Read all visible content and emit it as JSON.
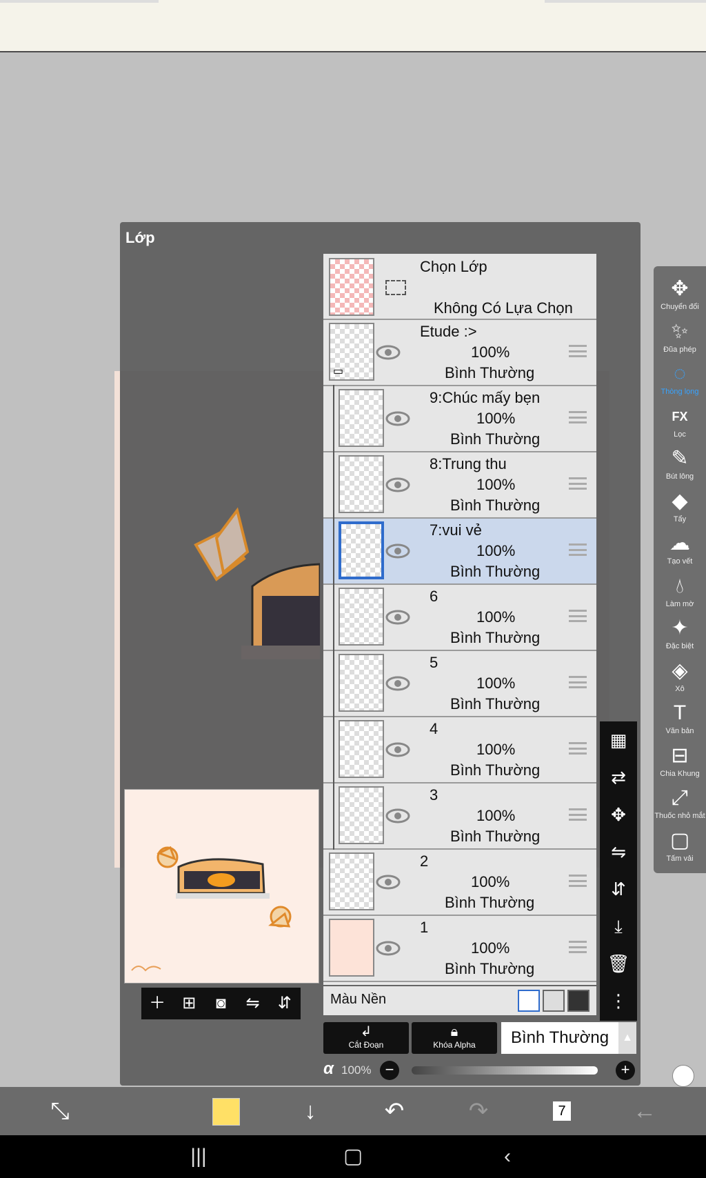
{
  "panel": {
    "title": "Lớp"
  },
  "select_layer": {
    "title": "Chọn Lớp",
    "subtitle": "Không Có Lựa Chọn"
  },
  "layers": [
    {
      "name": "Etude :>",
      "opacity": "100%",
      "mode": "Bình Thường",
      "folder": true
    },
    {
      "name": "9:Chúc mấy bẹn",
      "opacity": "100%",
      "mode": "Bình Thường"
    },
    {
      "name": "8:Trung thu",
      "opacity": "100%",
      "mode": "Bình Thường"
    },
    {
      "name": "7:vui vẻ",
      "opacity": "100%",
      "mode": "Bình Thường",
      "selected": true
    },
    {
      "name": "6",
      "opacity": "100%",
      "mode": "Bình Thường"
    },
    {
      "name": "5",
      "opacity": "100%",
      "mode": "Bình Thường"
    },
    {
      "name": "4",
      "opacity": "100%",
      "mode": "Bình Thường"
    },
    {
      "name": "3",
      "opacity": "100%",
      "mode": "Bình Thường"
    },
    {
      "name": "2",
      "opacity": "100%",
      "mode": "Bình Thường"
    },
    {
      "name": "1",
      "opacity": "100%",
      "mode": "Bình Thường"
    }
  ],
  "background": {
    "label": "Màu Nền"
  },
  "actions": {
    "clip": "Cắt Đoạn",
    "alpha_lock": "Khóa Alpha",
    "blend_mode": "Bình Thường"
  },
  "alpha": {
    "symbol": "α",
    "value": "100%"
  },
  "tools": [
    {
      "label": "Chuyển đổi",
      "icon": "move-icon"
    },
    {
      "label": "Đũa phép",
      "icon": "magic-wand-icon"
    },
    {
      "label": "Thòng lọng",
      "icon": "lasso-icon",
      "active": true
    },
    {
      "label": "Lọc",
      "icon": "fx-icon"
    },
    {
      "label": "Bút lông",
      "icon": "brush-icon"
    },
    {
      "label": "Tẩy",
      "icon": "eraser-icon"
    },
    {
      "label": "Tạo vết",
      "icon": "smudge-icon"
    },
    {
      "label": "Làm mờ",
      "icon": "blur-icon"
    },
    {
      "label": "Đặc biệt",
      "icon": "special-icon"
    },
    {
      "label": "Xô",
      "icon": "bucket-icon"
    },
    {
      "label": "Văn bản",
      "icon": "text-icon"
    },
    {
      "label": "Chia Khung",
      "icon": "frame-divider-icon"
    },
    {
      "label": "Thuốc nhỏ mắt",
      "icon": "eyedropper-icon"
    },
    {
      "label": "Tấm vải",
      "icon": "canvas-icon"
    }
  ],
  "bottom": {
    "color": "#ffe066",
    "layer_count": "7"
  },
  "colors": {
    "selected_row": "#cbd8ec",
    "accent": "#2f6ccc",
    "active_tool": "#37a3ff"
  }
}
